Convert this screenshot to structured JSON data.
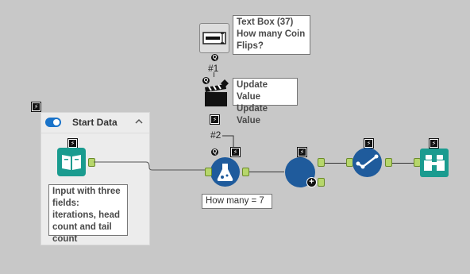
{
  "container": {
    "title": "Start Data",
    "toggle_on": true,
    "collapse_glyph": "⌃"
  },
  "input_annotation": "Input with three fields: iterations, head count and tail count",
  "textbox_annotation": "Text Box (37) How many Coin Flips?",
  "update_annotation": "Update Value Update Value",
  "connection_labels": {
    "first": "#1",
    "second": "#2"
  },
  "formula_annotation": "How many = 7",
  "icons": {
    "input": "book-icon",
    "textbox": "text-box-icon",
    "action": "clapperboard-icon",
    "formula": "flask-icon",
    "join": "circle-plus-icon",
    "check": "checkmark-icon",
    "browse": "binoculars-icon"
  },
  "colors": {
    "canvas": "#c8c8c8",
    "port": "#b6d66b",
    "tool_blue": "#1f5b9c",
    "teal": "#1a9b8f"
  }
}
